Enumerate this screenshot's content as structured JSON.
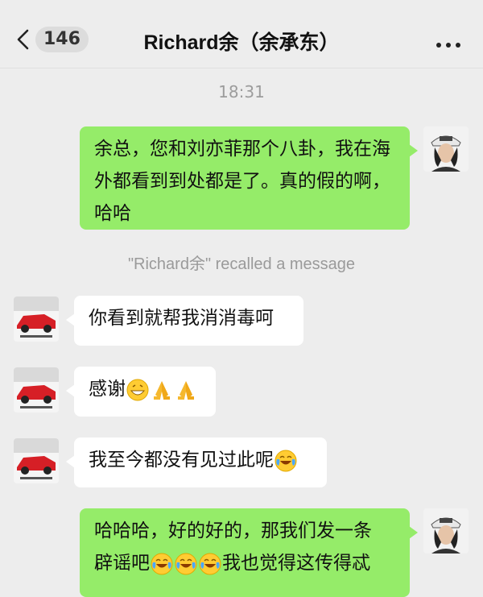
{
  "header": {
    "back_count": "146",
    "title": "Richard余（余承东）"
  },
  "chat": {
    "timestamp": "18:31",
    "recall_notice": "\"Richard余\" recalled a message",
    "messages": [
      {
        "sender": "me",
        "text": "余总，您和刘亦菲那个八卦，我在海外都看到到处都是了。真的假的啊，哈哈"
      },
      {
        "sender": "Richard余",
        "text": "你看到就帮我消消毒呵"
      },
      {
        "sender": "Richard余",
        "text": "感谢",
        "emojis": [
          "grin-icon",
          "pray-icon",
          "pray-icon"
        ]
      },
      {
        "sender": "Richard余",
        "text": "我至今都没有见过此呢",
        "emojis": [
          "laugh-cry-icon"
        ]
      },
      {
        "sender": "me",
        "text_1": "哈哈哈，好的好的，那我们发一条",
        "text_2": "辟谣吧",
        "text_3": "我也觉得这传得忒",
        "emojis": [
          "laugh-cry-icon",
          "laugh-cry-icon",
          "laugh-cry-icon"
        ]
      }
    ]
  },
  "colors": {
    "background": "#ededed",
    "outgoing_bubble": "#95ec69",
    "incoming_bubble": "#ffffff"
  }
}
